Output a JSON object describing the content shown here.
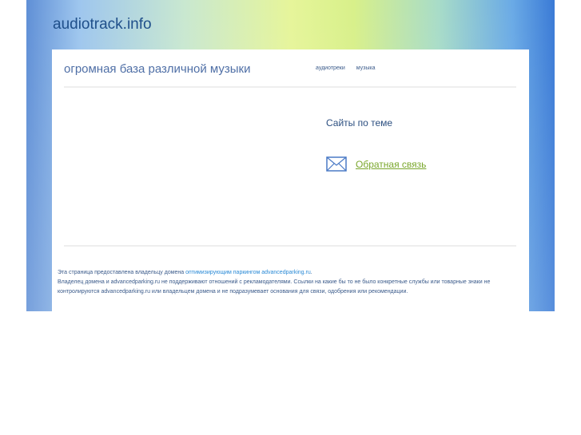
{
  "site_title": "audiotrack.info",
  "tagline": "огромная база различной музыки",
  "nav": [
    "аудиотреки",
    "музыка"
  ],
  "related_heading": "Сайты по теме",
  "feedback_link": "Обратная связь",
  "footer": {
    "line1_prefix": "Эта страница предоставлена владельцу домена ",
    "line1_link": "оптимизирующим паркингом advancedparking.ru",
    "line1_suffix": ".",
    "line2": "Владелец домена и advancedparking.ru не поддерживают отношений с рекламодателями. Ссылки на какие бы то не было конкретные службы или товарные знаки не контролируются advancedparking.ru или владельцем домена и не подразумевает основания для связи, одобрения или рекомендации."
  }
}
